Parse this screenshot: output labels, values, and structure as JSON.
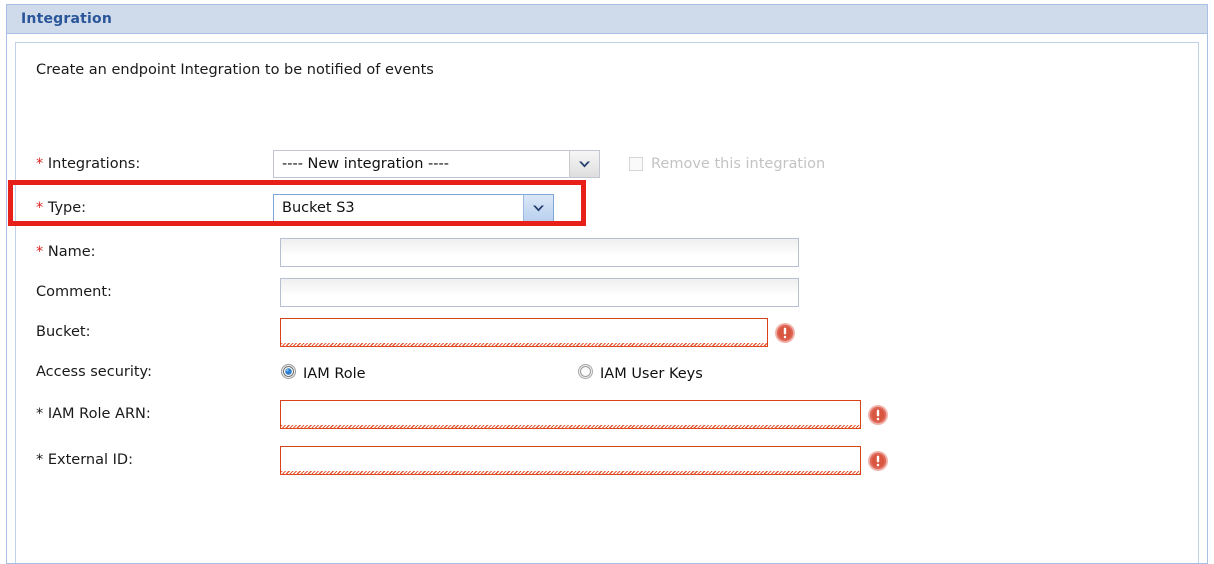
{
  "panel": {
    "title": "Integration",
    "intro": "Create an endpoint Integration to be notified of events"
  },
  "form": {
    "rows": [
      {
        "label": "Integrations:",
        "required": true,
        "required_marker": "*",
        "marker_color": "#e02020",
        "control": "select",
        "value": "---- New integration ----"
      },
      {
        "label": "Type:",
        "required": true,
        "required_marker": "*",
        "marker_color": "#e02020",
        "control": "select",
        "value": "Bucket S3",
        "focused": true,
        "annotated": true
      },
      {
        "label": "Name:",
        "required": true,
        "required_marker": "*",
        "marker_color": "#e02020",
        "control": "text",
        "value": "",
        "placeholder": ""
      },
      {
        "label": "Comment:",
        "required": false,
        "required_marker": "",
        "control": "text",
        "value": "",
        "placeholder": ""
      },
      {
        "label": "Bucket:",
        "required": false,
        "required_marker": "",
        "control": "text",
        "value": "",
        "placeholder": "",
        "error": true
      },
      {
        "label": "Access security:",
        "required": false,
        "required_marker": "",
        "control": "radio-group"
      },
      {
        "label": "IAM Role ARN:",
        "required": true,
        "required_marker": "*",
        "marker_color": "#1a1a1a",
        "control": "text",
        "value": "",
        "placeholder": "",
        "error": true
      },
      {
        "label": "External ID:",
        "required": true,
        "required_marker": "*",
        "marker_color": "#1a1a1a",
        "control": "text",
        "value": "",
        "placeholder": "",
        "error": true
      }
    ],
    "remove_checkbox": {
      "label": "Remove this integration",
      "checked": false,
      "disabled": true
    },
    "access_security": {
      "selected": "IAM Role",
      "options": [
        {
          "label": "IAM Role",
          "selected": true
        },
        {
          "label": "IAM User Keys",
          "selected": false
        }
      ]
    }
  },
  "colors": {
    "panel_border": "#a9c0e4",
    "header_bg": "#cfdbeb",
    "title_text": "#2a5699",
    "required_asterisk": "#e02020",
    "error_border": "#d84315",
    "error_icon": "#e0685a",
    "annotation_box": "#e8201a",
    "focus_border": "#7ea7d8"
  },
  "icons": {
    "dropdown": "chevron-down-icon",
    "error": "error-exclamation-icon"
  }
}
